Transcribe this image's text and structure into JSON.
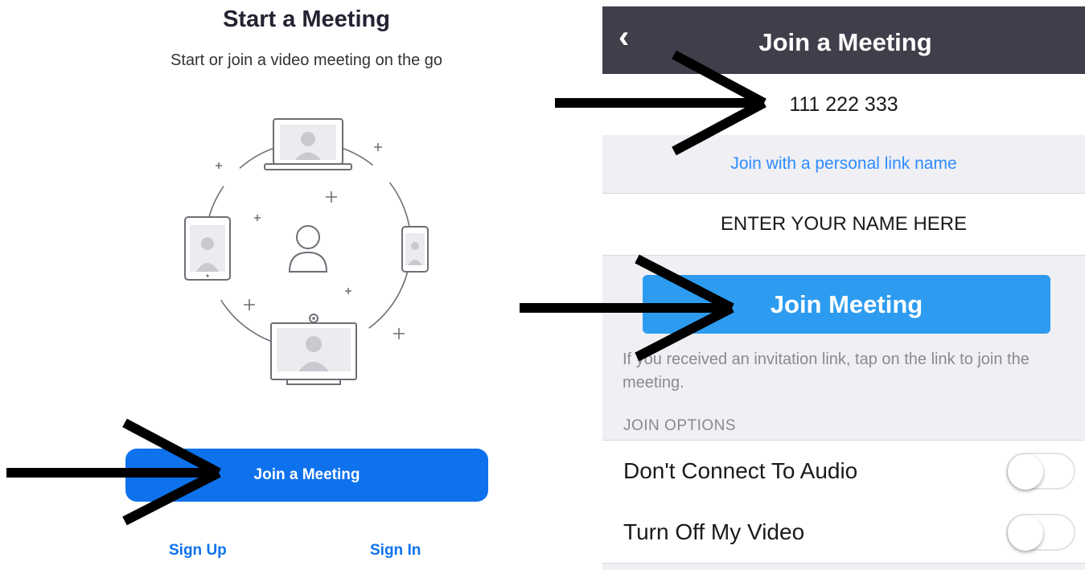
{
  "left_screen": {
    "title": "Start a Meeting",
    "subtitle": "Start or join a video meeting on the go",
    "illustration": "video-meeting-devices-illustration",
    "join_button_label": "Join a Meeting",
    "sign_up_label": "Sign Up",
    "sign_in_label": "Sign In",
    "accent_color": "#0e72ed"
  },
  "right_screen": {
    "nav": {
      "back_icon": "chevron-left-icon",
      "title": "Join a Meeting"
    },
    "meeting_id_value": "111 222 333",
    "personal_link_label": "Join with a personal link name",
    "name_value": "ENTER YOUR NAME HERE",
    "join_button_label": "Join Meeting",
    "invite_hint": "If you received an invitation link, tap on the link to join the meeting.",
    "join_options_header": "JOIN OPTIONS",
    "options": [
      {
        "label": "Don't Connect To Audio",
        "enabled": false
      },
      {
        "label": "Turn Off My Video",
        "enabled": false
      }
    ],
    "button_color": "#2d9cf0",
    "nav_color": "#3f3f4c"
  },
  "annotations": {
    "arrow_color": "#000000",
    "arrow_targets": [
      "meeting-id-field",
      "join-meeting-button-right",
      "join-a-meeting-button-left"
    ]
  }
}
